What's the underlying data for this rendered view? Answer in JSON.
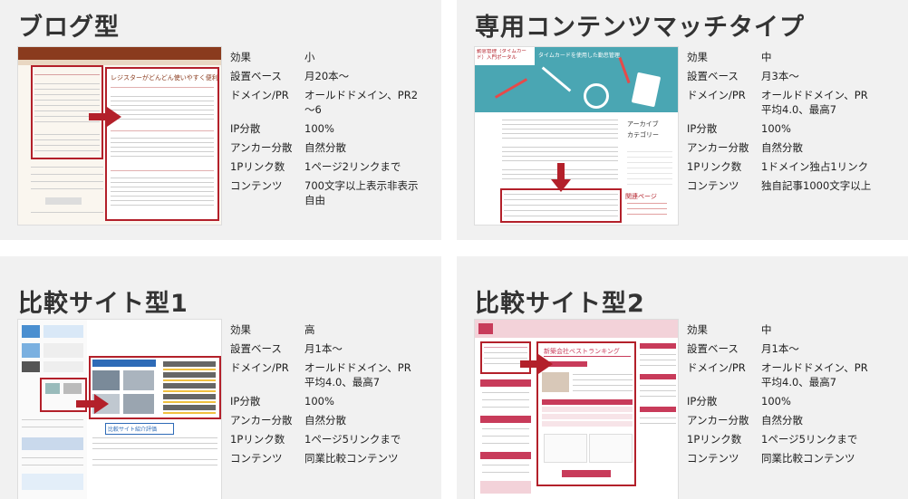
{
  "cards": [
    {
      "title": "ブログ型",
      "rows": [
        {
          "k": "効果",
          "v": "小"
        },
        {
          "k": "設置ベース",
          "v": "月20本～"
        },
        {
          "k": "ドメイン/PR",
          "v": "オールドドメイン、PR2～6"
        },
        {
          "k": "IP分散",
          "v": "100%"
        },
        {
          "k": "アンカー分散",
          "v": "自然分散"
        },
        {
          "k": "1Pリンク数",
          "v": "1ページ2リンクまで"
        },
        {
          "k": "コンテンツ",
          "v": "700文字以上表示非表示自由"
        }
      ],
      "thumb_text": {
        "zoom_heading": "レジスターがどんどん使いやすく便利に！"
      }
    },
    {
      "title": "専用コンテンツマッチタイプ",
      "rows": [
        {
          "k": "効果",
          "v": "中"
        },
        {
          "k": "設置ベース",
          "v": "月3本～"
        },
        {
          "k": "ドメイン/PR",
          "v": "オールドドメイン、PR平均4.0、最高7"
        },
        {
          "k": "IP分散",
          "v": "100%"
        },
        {
          "k": "アンカー分散",
          "v": "自然分散"
        },
        {
          "k": "1Pリンク数",
          "v": "1ドメイン独占1リンク"
        },
        {
          "k": "コンテンツ",
          "v": "独自記事1000文字以上"
        }
      ],
      "thumb_text": {
        "site_name": "勤怠管理（タイムカード）入門ポータル",
        "banner": "タイムカードを使用した勤怠管理",
        "archive": "アーカイブ",
        "category": "カテゴリー",
        "related": "関連ページ"
      }
    },
    {
      "title": "比較サイト型1",
      "rows": [
        {
          "k": "効果",
          "v": "高"
        },
        {
          "k": "設置ベース",
          "v": "月1本～"
        },
        {
          "k": "ドメイン/PR",
          "v": "オールドドメイン、PR平均4.0、最高7"
        },
        {
          "k": "IP分散",
          "v": "100%"
        },
        {
          "k": "アンカー分散",
          "v": "自然分散"
        },
        {
          "k": "1Pリンク数",
          "v": "1ページ5リンクまで"
        },
        {
          "k": "コンテンツ",
          "v": "同業比較コンテンツ"
        }
      ],
      "thumb_text": {
        "compare_label": "比較サイト紹介評価"
      }
    },
    {
      "title": "比較サイト型2",
      "rows": [
        {
          "k": "効果",
          "v": "中"
        },
        {
          "k": "設置ベース",
          "v": "月1本～"
        },
        {
          "k": "ドメイン/PR",
          "v": "オールドドメイン、PR平均4.0、最高7"
        },
        {
          "k": "IP分散",
          "v": "100%"
        },
        {
          "k": "アンカー分散",
          "v": "自然分散"
        },
        {
          "k": "1Pリンク数",
          "v": "1ページ5リンクまで"
        },
        {
          "k": "コンテンツ",
          "v": "同業比較コンテンツ"
        }
      ],
      "thumb_text": {
        "ranking_title": "新築会社ベストランキング"
      }
    }
  ],
  "colors": {
    "card_bg": "#f1f1f1",
    "highlight_red": "#b3202a",
    "teal": "#4aa6b3",
    "pink": "#c83b5a"
  }
}
